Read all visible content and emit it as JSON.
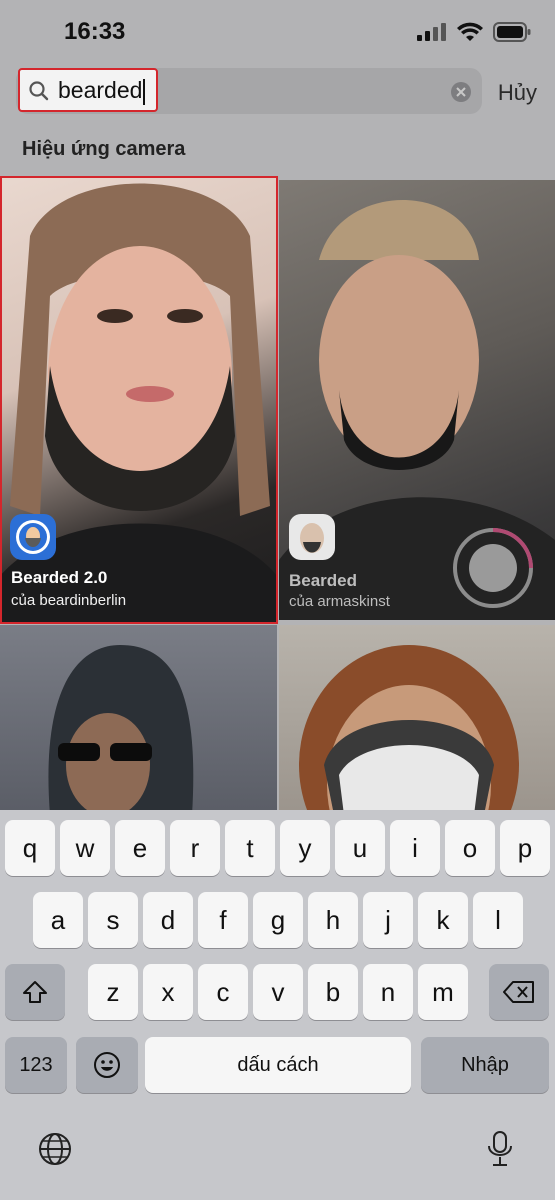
{
  "status_bar": {
    "time": "16:33"
  },
  "search": {
    "query": "bearded",
    "cancel_label": "Hủy"
  },
  "section_title": "Hiệu ứng camera",
  "effects": [
    {
      "name": "Bearded 2.0",
      "author": "của beardinberlin"
    },
    {
      "name": "Bearded",
      "author": "của armaskinst"
    }
  ],
  "keyboard": {
    "row1": [
      "q",
      "w",
      "e",
      "r",
      "t",
      "y",
      "u",
      "i",
      "o",
      "p"
    ],
    "row2": [
      "a",
      "s",
      "d",
      "f",
      "g",
      "h",
      "j",
      "k",
      "l"
    ],
    "row3": [
      "z",
      "x",
      "c",
      "v",
      "b",
      "n",
      "m"
    ],
    "numbers_label": "123",
    "space_label": "dấu cách",
    "return_label": "Nhập"
  },
  "colors": {
    "highlight": "#d4262c"
  }
}
